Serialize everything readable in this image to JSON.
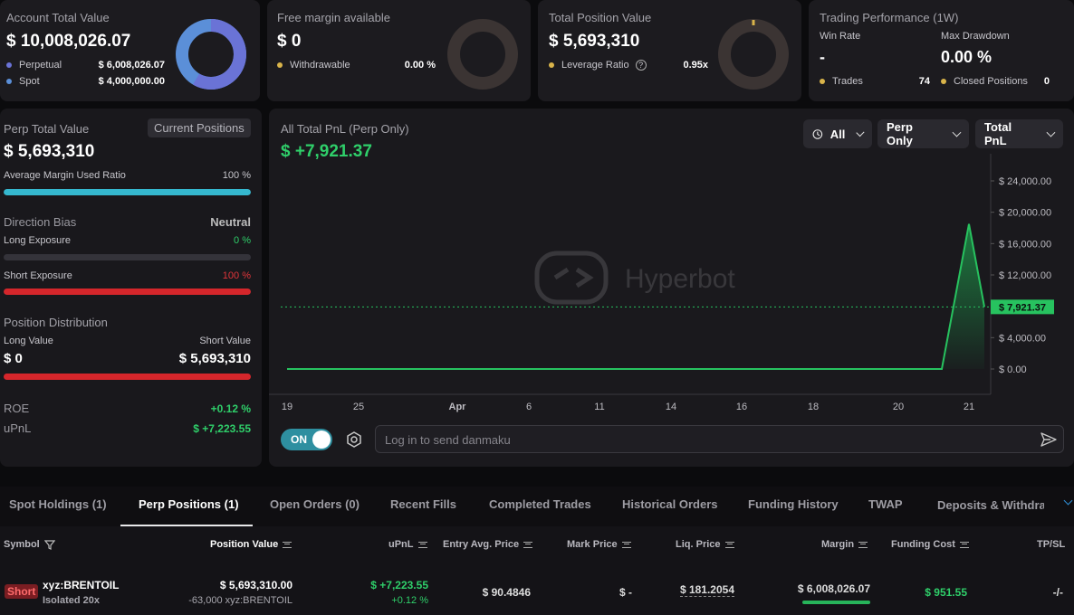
{
  "summary": {
    "account": {
      "title": "Account Total Value",
      "value": "$ 10,008,026.07",
      "perp_label": "Perpetual",
      "perp_value": "$ 6,008,026.07",
      "spot_label": "Spot",
      "spot_value": "$ 4,000,000.00",
      "perp_share": 0.6,
      "colors": {
        "perp": "#6a73d6",
        "spot": "#5b8fd8"
      }
    },
    "free_margin": {
      "title": "Free margin available",
      "value": "$ 0",
      "withdrawable_label": "Withdrawable",
      "withdrawable_value": "0.00 %"
    },
    "position": {
      "title": "Total Position Value",
      "value": "$ 5,693,310",
      "leverage_label": "Leverage Ratio",
      "leverage_value": "0.95x"
    },
    "performance": {
      "title": "Trading Performance (1W)",
      "win_rate_label": "Win Rate",
      "win_rate_value": "-",
      "max_dd_label": "Max Drawdown",
      "max_dd_value": "0.00 %",
      "trades_label": "Trades",
      "trades_value": "74",
      "closed_label": "Closed Positions",
      "closed_value": "0"
    }
  },
  "perp_panel": {
    "title": "Perp Total Value",
    "current_positions_btn": "Current Positions",
    "value": "$ 5,693,310",
    "avg_margin_label": "Average Margin Used Ratio",
    "avg_margin_value": "100 %",
    "avg_margin_ratio": 1.0,
    "direction_label": "Direction Bias",
    "direction_value": "Neutral",
    "long_exp_label": "Long Exposure",
    "long_exp_value": "0 %",
    "long_exp_ratio": 0,
    "short_exp_label": "Short Exposure",
    "short_exp_value": "100 %",
    "short_exp_ratio": 1.0,
    "distribution_label": "Position Distribution",
    "long_value_label": "Long Value",
    "short_value_label": "Short Value",
    "long_value": "$ 0",
    "short_value": "$ 5,693,310",
    "roe_label": "ROE",
    "roe_value": "+0.12 %",
    "upnl_label": "uPnL",
    "upnl_value": "$ +7,223.55"
  },
  "chart_panel": {
    "title": "All Total PnL (Perp Only)",
    "value": "$ +7,921.37",
    "filters": {
      "range": "All",
      "scope": "Perp Only",
      "metric": "Total PnL"
    },
    "watermark": "Hyperbot",
    "danmaku_toggle": "ON",
    "danmaku_placeholder": "Log in to send danmaku",
    "current_tag": "$ 7,921.37"
  },
  "chart_data": {
    "type": "area",
    "title": "All Total PnL (Perp Only)",
    "x_ticks": [
      "19",
      "25",
      "Apr",
      "6",
      "11",
      "14",
      "16",
      "18",
      "20",
      "21"
    ],
    "y_ticks": [
      "$ 0.00",
      "$ 4,000.00",
      "$ 8,000.00",
      "$ 12,000.00",
      "$ 16,000.00",
      "$ 20,000.00",
      "$ 24,000.00"
    ],
    "ylim": [
      0,
      24000
    ],
    "series": [
      {
        "values": [
          0,
          0,
          0,
          0,
          0,
          0,
          0,
          0,
          0,
          0,
          18500,
          7921.37
        ]
      }
    ],
    "current_value": 7921.37,
    "colors": {
      "line": "#27c25f",
      "fill": "#1d8f47"
    }
  },
  "tabs": [
    "Spot Holdings (1)",
    "Perp Positions (1)",
    "Open Orders (0)",
    "Recent Fills",
    "Completed Trades",
    "Historical Orders",
    "Funding History",
    "TWAP",
    "Deposits & Withdraw"
  ],
  "table": {
    "headers": {
      "symbol": "Symbol",
      "position_value": "Position Value",
      "upnl": "uPnL",
      "entry": "Entry Avg. Price",
      "mark": "Mark Price",
      "liq": "Liq. Price",
      "margin": "Margin",
      "funding": "Funding Cost",
      "tpsl": "TP/SL"
    },
    "row": {
      "side": "Short",
      "symbol": "xyz:BRENTOIL",
      "mode": "Isolated 20x",
      "position_value": "$ 5,693,310.00",
      "position_size": "-63,000 xyz:BRENTOIL",
      "upnl": "$ +7,223.55",
      "upnl_pct": "+0.12 %",
      "entry": "$ 90.4846",
      "mark": "$ -",
      "liq": "$ 181.2054",
      "margin": "$ 6,008,026.07",
      "funding": "$ 951.55",
      "tpsl": "-/-"
    }
  }
}
